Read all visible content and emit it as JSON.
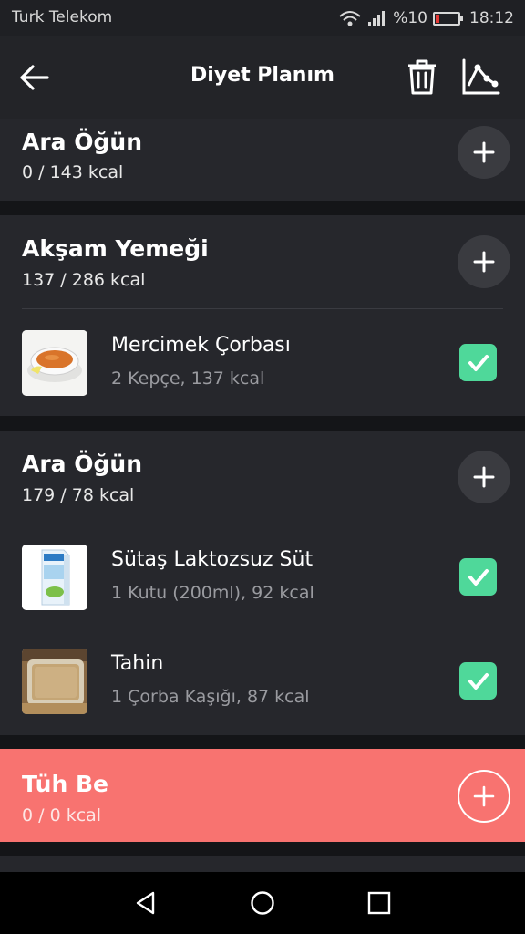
{
  "status_bar": {
    "carrier": "Turk Telekom",
    "battery": "%10",
    "time": "18:12"
  },
  "app_bar": {
    "title": "Diyet Planım"
  },
  "meals": [
    {
      "title": "Ara Öğün",
      "kcal": "0 / 143 kcal",
      "items": []
    },
    {
      "title": "Akşam Yemeği",
      "kcal": "137 / 286 kcal",
      "items": [
        {
          "name": "Mercimek Çorbası",
          "detail": "2 Kepçe, 137 kcal",
          "checked": true
        }
      ]
    },
    {
      "title": "Ara Öğün",
      "kcal": "179 / 78 kcal",
      "items": [
        {
          "name": "Sütaş Laktozsuz Süt",
          "detail": "1 Kutu (200ml), 92 kcal",
          "checked": true
        },
        {
          "name": "Tahin",
          "detail": "1 Çorba Kaşığı, 87 kcal",
          "checked": true
        }
      ]
    },
    {
      "title": "Tüh Be",
      "kcal": "0 / 0 kcal",
      "items": []
    }
  ],
  "colors": {
    "accent_green": "#4fd89a",
    "cheat_red": "#f87370",
    "card": "#26272c",
    "background": "#141518"
  },
  "icons": [
    "back-arrow-icon",
    "trash-icon",
    "chart-icon",
    "plus-icon",
    "checkmark-icon",
    "nav-back-icon",
    "nav-home-icon",
    "nav-recents-icon"
  ]
}
